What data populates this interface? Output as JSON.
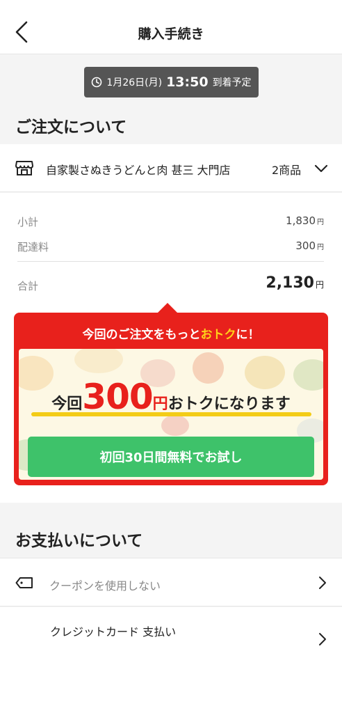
{
  "header": {
    "title": "購入手続き"
  },
  "eta": {
    "date": "1月26日(月)",
    "time": "13:50",
    "suffix": "到着予定"
  },
  "order": {
    "section_title": "ご注文について",
    "store_name": "自家製さぬきうどんと肉 甚三 大門店",
    "item_count": "2商品",
    "subtotal_label": "小計",
    "subtotal_value": "1,830",
    "delivery_label": "配達料",
    "delivery_value": "300",
    "total_label": "合計",
    "total_value": "2,130",
    "currency": "円"
  },
  "promo": {
    "headline_pre": "今回のご注文をもっと",
    "headline_accent": "おトク",
    "headline_post": "に！",
    "save_pre": "今回",
    "save_amount": "300",
    "save_currency": "円",
    "save_post": "おトクになります",
    "trial_button": "初回30日間無料でお試し"
  },
  "payment": {
    "section_title": "お支払いについて",
    "coupon_label": "クーポンを使用しない",
    "method_label": "クレジットカード 支払い"
  },
  "colors": {
    "brand_red": "#e8211c",
    "accent_yellow": "#ffd21a",
    "trial_green": "#3ec26a"
  }
}
